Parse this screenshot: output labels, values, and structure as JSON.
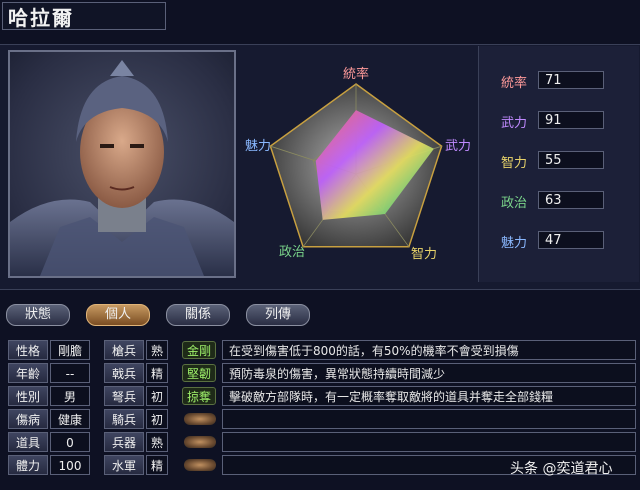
{
  "officer": {
    "name": "哈拉爾"
  },
  "radar": {
    "labels": {
      "command": "統率",
      "war": "武力",
      "intelligence": "智力",
      "politics": "政治",
      "charm": "魅力"
    },
    "colors": {
      "command": "#ff9a9a",
      "war": "#c08aff",
      "intelligence": "#e8d36a",
      "politics": "#7ad48a",
      "charm": "#8ab8ff"
    },
    "values": {
      "command": 71,
      "war": 91,
      "intelligence": 55,
      "politics": 63,
      "charm": 47
    },
    "max": 100
  },
  "stats": [
    {
      "label": "統率",
      "value": "71",
      "color": "#ff9a9a"
    },
    {
      "label": "武力",
      "value": "91",
      "color": "#c08aff"
    },
    {
      "label": "智力",
      "value": "55",
      "color": "#e8d36a"
    },
    {
      "label": "政治",
      "value": "63",
      "color": "#7ad48a"
    },
    {
      "label": "魅力",
      "value": "47",
      "color": "#8ab8ff"
    }
  ],
  "tabs": [
    "狀態",
    "個人",
    "關係",
    "列傳"
  ],
  "personal": [
    {
      "label": "性格",
      "value": "剛膽"
    },
    {
      "label": "年齡",
      "value": "--"
    },
    {
      "label": "性別",
      "value": "男"
    },
    {
      "label": "傷病",
      "value": "健康"
    },
    {
      "label": "道具",
      "value": "0"
    },
    {
      "label": "體力",
      "value": "100"
    }
  ],
  "aptitude": [
    {
      "label": "槍兵",
      "value": "熟"
    },
    {
      "label": "戟兵",
      "value": "精"
    },
    {
      "label": "弩兵",
      "value": "初"
    },
    {
      "label": "騎兵",
      "value": "初"
    },
    {
      "label": "兵器",
      "value": "熟"
    },
    {
      "label": "水軍",
      "value": "精"
    }
  ],
  "skills": [
    {
      "name": "金剛",
      "desc": "在受到傷害低于800的話，有50%的機率不會受到損傷"
    },
    {
      "name": "堅韌",
      "desc": "預防毒泉的傷害，異常狀態持續時間減少"
    },
    {
      "name": "掠奪",
      "desc": "擊破敵方部隊時，有一定概率奪取敵將的道具并奪走全部錢糧"
    },
    {
      "name": "",
      "desc": ""
    },
    {
      "name": "",
      "desc": ""
    },
    {
      "name": "",
      "desc": ""
    }
  ],
  "watermark": "头条 @奕道君心"
}
